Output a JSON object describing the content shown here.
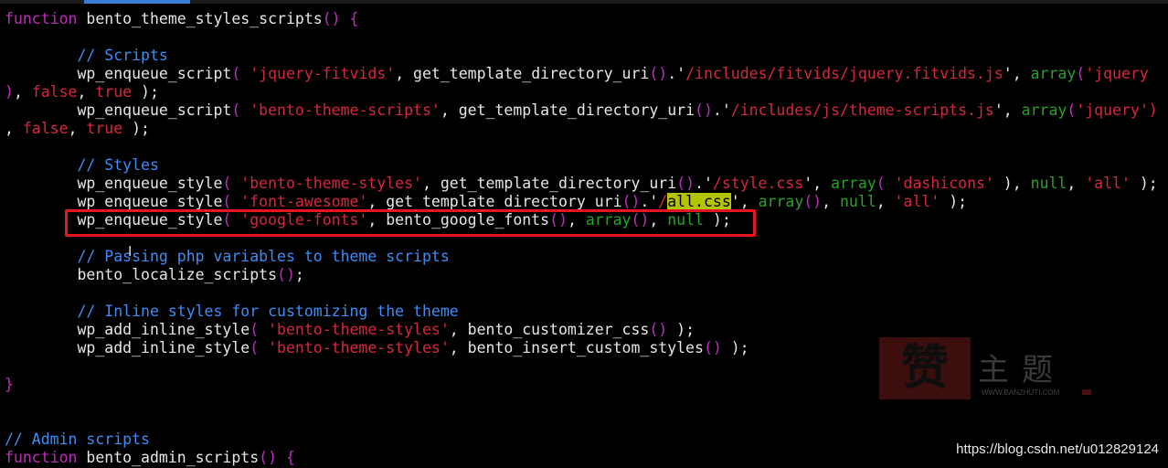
{
  "editor": {
    "lines": {
      "l1": {
        "a": "function",
        "b": " bento_theme_styles_scripts",
        "c": "()",
        "d": " {"
      },
      "l3": {
        "a": "        ",
        "b": "// Scripts"
      },
      "l4": {
        "a": "        wp_enqueue_script",
        "b": "(",
        "c": " ",
        "d": "'jquery-fitvids'",
        "e": ", get_template_directory_uri",
        "f": "()",
        "g": ".'",
        "h": "/includes/fitvids/jquery.fitvids.js",
        "i": "', ",
        "j": "array",
        "k": "(",
        "l": "'jquery"
      },
      "l5": {
        "a": ")",
        "b": ", ",
        "c": "false",
        "d": ", ",
        "e": "true",
        "f": " );"
      },
      "l6": {
        "a": "        wp_enqueue_script",
        "b": "(",
        "c": " ",
        "d": "'bento-theme-scripts'",
        "e": ", get_template_directory_uri",
        "f": "()",
        "g": ".'",
        "h": "/includes/js/theme-scripts.js",
        "i": "', ",
        "j": "array",
        "k": "(",
        "l": "'jquery')"
      },
      "l7": {
        "a": ", ",
        "b": "false",
        "c": ", ",
        "d": "true",
        "e": " );"
      },
      "l9": {
        "a": "        ",
        "b": "// Styles"
      },
      "l10": {
        "a": "        wp_enqueue_style",
        "b": "(",
        "c": " ",
        "d": "'bento-theme-styles'",
        "e": ", get_template_directory_uri",
        "f": "()",
        "g": ".'",
        "h": "/style.css",
        "i": "', ",
        "j": "array",
        "k": "(",
        "l": " ",
        "m": "'dashicons'",
        "n": " ), ",
        "o": "null",
        "p": ", ",
        "q": "'all'",
        "r": " );"
      },
      "l11": {
        "a": "        wp_enqueue_style",
        "b": "(",
        "c": " ",
        "d": "'font-awesome'",
        "e": ", get_template_directory_uri",
        "f": "()",
        "g": ".'",
        "h": "/",
        "i": "all.css",
        "j": "'",
        "k": ", ",
        "l": "array",
        "m": "()",
        "n": ", ",
        "o": "null",
        "p": ", ",
        "q": "'all'",
        "r": " );"
      },
      "l12": {
        "a": "        wp_enqueue_style",
        "b": "(",
        "c": " ",
        "d": "'google-fonts'",
        "e": ", bento_google_fonts",
        "f": "()",
        "g": ", ",
        "h": "array",
        "i": "()",
        "j": ", ",
        "k": "null",
        "l": " );"
      },
      "l14": {
        "a": "        ",
        "b": "// Passing php variables to theme scripts"
      },
      "l15": {
        "a": "        bento_localize_scripts",
        "b": "()",
        "c": ";"
      },
      "l17": {
        "a": "        ",
        "b": "// Inline styles for customizing the theme"
      },
      "l18": {
        "a": "        wp_add_inline_style",
        "b": "(",
        "c": " ",
        "d": "'bento-theme-styles'",
        "e": ", bento_customizer_css",
        "f": "()",
        "g": " );"
      },
      "l19": {
        "a": "        wp_add_inline_style",
        "b": "(",
        "c": " ",
        "d": "'bento-theme-styles'",
        "e": ", bento_insert_custom_styles",
        "f": "()",
        "g": " );"
      },
      "l21": {
        "a": "}"
      },
      "l24": {
        "a": "// Admin scripts"
      },
      "l25": {
        "a": "function",
        "b": " bento_admin_scripts",
        "c": "()",
        "d": " {"
      }
    }
  },
  "watermark": {
    "logo_char": "赞",
    "name": "主题",
    "url": "WWW.BANZHUTI.COM"
  },
  "credit": "https://blog.csdn.net/u012829124",
  "cursor_glyph": "I",
  "colors": {
    "background": "#000000",
    "keyword": "#c02cc0",
    "comment": "#3d8df5",
    "string": "#d5283c",
    "builtin": "#26a326",
    "highlight_box": "#e8141e",
    "search_highlight": "#b5c400"
  }
}
